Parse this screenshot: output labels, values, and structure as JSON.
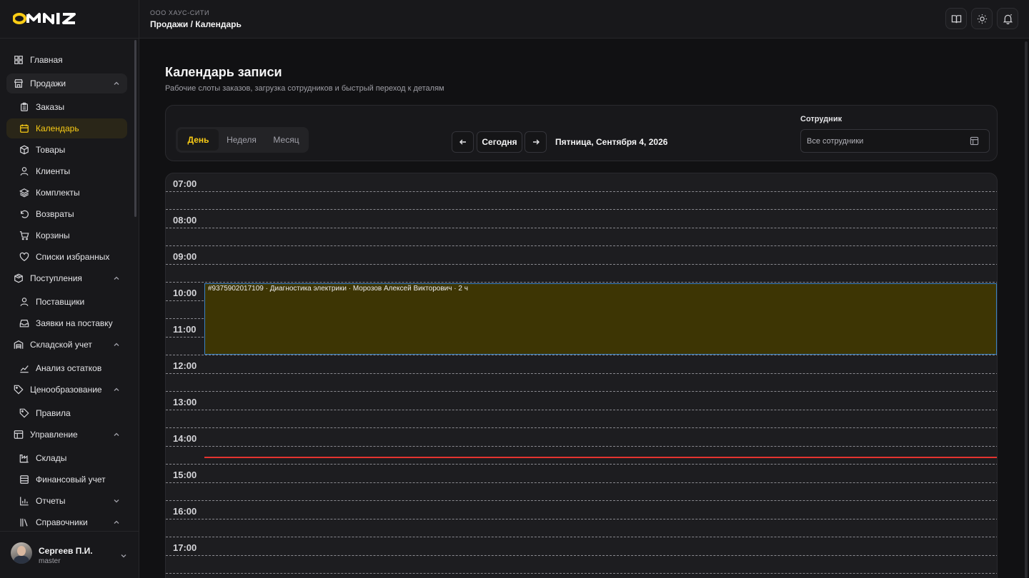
{
  "brand": {
    "logo_text": "OMNIZ",
    "accent": "#facc15"
  },
  "header": {
    "company": "ООО ХАУС-СИТИ",
    "breadcrumb": "Продажи / Календарь",
    "buttons": [
      "book-icon",
      "sun-icon",
      "bell-icon"
    ]
  },
  "sidebar": {
    "items": [
      {
        "label": "Главная",
        "icon": "grid-icon"
      },
      {
        "label": "Продажи",
        "icon": "store-icon"
      },
      {
        "label": "Заказы",
        "icon": "clipboard-icon"
      },
      {
        "label": "Календарь",
        "icon": "calendar-icon"
      },
      {
        "label": "Товары",
        "icon": "box-icon"
      },
      {
        "label": "Клиенты",
        "icon": "user-icon"
      },
      {
        "label": "Комплекты",
        "icon": "layers-icon"
      },
      {
        "label": "Возвраты",
        "icon": "undo-icon"
      },
      {
        "label": "Корзины",
        "icon": "cart-icon"
      },
      {
        "label": "Списки избранных",
        "icon": "heart-icon"
      },
      {
        "label": "Поступления",
        "icon": "package-icon"
      },
      {
        "label": "Поставщики",
        "icon": "user-icon"
      },
      {
        "label": "Заявки на поставку",
        "icon": "inbox-icon"
      },
      {
        "label": "Складской учет",
        "icon": "warehouse-icon"
      },
      {
        "label": "Анализ остатков",
        "icon": "chart-line-icon"
      },
      {
        "label": "Ценообразование",
        "icon": "tag-icon"
      },
      {
        "label": "Правила",
        "icon": "tag-icon"
      },
      {
        "label": "Управление",
        "icon": "table-icon"
      },
      {
        "label": "Склады",
        "icon": "factory-icon"
      },
      {
        "label": "Финансовый учет",
        "icon": "wallet-icon"
      },
      {
        "label": "Отчеты",
        "icon": "bar-chart-icon"
      },
      {
        "label": "Справочники",
        "icon": "library-icon"
      }
    ],
    "user": {
      "name": "Сергеев П.И.",
      "role": "master"
    }
  },
  "page": {
    "title": "Календарь записи",
    "subtitle": "Рабочие слоты заказов, загрузка сотрудников и быстрый переход к деталям"
  },
  "toolbar": {
    "views": [
      "День",
      "Неделя",
      "Месяц"
    ],
    "active_view": "День",
    "today_label": "Сегодня",
    "date_label": "Пятница, Сентября 4, 2026",
    "employee_label": "Сотрудник",
    "employee_value": "Все сотрудники"
  },
  "calendar": {
    "hours": [
      "07:00",
      "08:00",
      "09:00",
      "10:00",
      "11:00",
      "12:00",
      "13:00",
      "14:00",
      "15:00",
      "16:00",
      "17:00"
    ],
    "events": [
      {
        "text": "#9375902017109 · Диагностика электрики · Морозов Алексей Викторович · 2 ч",
        "start": "10:00",
        "duration_hours": 2,
        "color": "#3d3504"
      }
    ],
    "current_time_color": "#e5342f"
  }
}
